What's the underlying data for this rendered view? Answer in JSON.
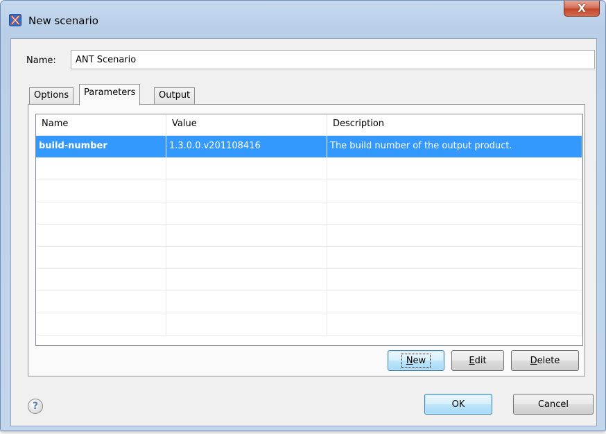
{
  "window": {
    "title": "New scenario",
    "close_label": "X",
    "app_icon": "oxygen-x-icon"
  },
  "name_field": {
    "label": "Name:",
    "value": "ANT Scenario"
  },
  "tabs": [
    {
      "label": "Options",
      "active": false
    },
    {
      "label": "Parameters",
      "active": true
    },
    {
      "label": "Output",
      "active": false
    }
  ],
  "parameters_table": {
    "columns": [
      "Name",
      "Value",
      "Description"
    ],
    "rows": [
      {
        "name": "build-number",
        "value": "1.3.0.0.v201108416",
        "description": "The build number of the output product.",
        "selected": true
      }
    ],
    "empty_rows": 8
  },
  "table_buttons": {
    "new": {
      "mnemonic": "N",
      "rest": "ew"
    },
    "edit": {
      "mnemonic": "E",
      "rest": "dit"
    },
    "delete": {
      "mnemonic": "D",
      "rest": "elete"
    }
  },
  "footer": {
    "help_icon": "?",
    "ok_label": "OK",
    "cancel_label": "Cancel"
  },
  "colors": {
    "selection": "#3399ff",
    "title_bar": "#c6d9ee",
    "close_button": "#c4482e"
  }
}
